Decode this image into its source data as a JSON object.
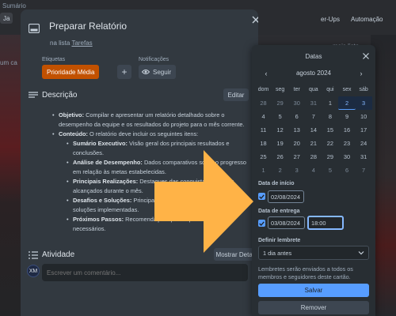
{
  "background": {
    "top_left_text": "Sumário",
    "board_btn": "Ja",
    "top_right_powerups": "er-Ups",
    "top_right_automation": "Automação",
    "left_fragment": "um ca",
    "right_fragment": "mais lista"
  },
  "card": {
    "title": "Preparar Relatório",
    "list_prefix": "na lista",
    "list_name": "Tarefas",
    "labels_heading": "Etiquetas",
    "label_chip": "Prioridade Média",
    "add_label": "+",
    "notifications_heading": "Notificações",
    "follow_label": "Seguir",
    "description_title": "Descrição",
    "edit_label": "Editar",
    "description": {
      "objective_key": "Objetivo:",
      "objective_text": " Compilar e apresentar um relatório detalhado sobre o desempenho da equipe e os resultados do projeto para o mês corrente.",
      "content_key": "Conteúdo:",
      "content_text": " O relatório deve incluir os seguintes itens:",
      "items": [
        {
          "key": "Sumário Executivo:",
          "text": " Visão geral dos principais resultados e conclusões."
        },
        {
          "key": "Análise de Desempenho:",
          "text": " Dados comparativos sobre o progresso em relação às metas estabelecidas."
        },
        {
          "key": "Principais Realizações:",
          "text": " Destaques das conquistas e marcos alcançados durante o mês."
        },
        {
          "key": "Desafios e Soluções:",
          "text": " Principais desafios enfrentados e as soluções implementadas."
        },
        {
          "key": "Próximos Passos:",
          "text": " Recomendações para o próximo mês, se necessários."
        }
      ]
    },
    "activity_title": "Atividade",
    "details_label": "Mostrar Detalhes",
    "avatar_initials": "XM",
    "comment_placeholder": "Escrever um comentário..."
  },
  "dates": {
    "title": "Datas",
    "prev_month": "‹",
    "next_month": "›",
    "month_label": "agosto 2024",
    "weekdays": [
      "dom",
      "seg",
      "ter",
      "qua",
      "qui",
      "sex",
      "sáb"
    ],
    "weeks": [
      [
        "28",
        "29",
        "30",
        "31",
        "1",
        "2",
        "3"
      ],
      [
        "4",
        "5",
        "6",
        "7",
        "8",
        "9",
        "10"
      ],
      [
        "11",
        "12",
        "13",
        "14",
        "15",
        "16",
        "17"
      ],
      [
        "18",
        "19",
        "20",
        "21",
        "22",
        "23",
        "24"
      ],
      [
        "25",
        "26",
        "27",
        "28",
        "29",
        "30",
        "31"
      ],
      [
        "1",
        "2",
        "3",
        "4",
        "5",
        "6",
        "7"
      ]
    ],
    "start_label": "Data de início",
    "start_value": "02/08/2024",
    "due_label": "Data de entrega",
    "due_date_value": "03/08/2024",
    "due_time_value": "18:00",
    "reminder_label": "Definir lembrete",
    "reminder_value": "1 dia antes",
    "help_text": "Lembretes serão enviados a todos os membros e seguidores deste cartão.",
    "save_label": "Salvar",
    "remove_label": "Remover"
  },
  "colors": {
    "modal_bg": "#323940",
    "popover_bg": "#282e33",
    "label_orange": "#c25100",
    "accent_blue": "#579dff",
    "overlay_arrow": "#ffb347"
  },
  "icons": {
    "card": "card-icon",
    "close": "close-icon",
    "eye": "eye-icon",
    "description": "description-icon",
    "activity": "activity-icon",
    "chevron_down": "chevron-down-icon",
    "check": "check-icon",
    "arrow": "arrow-right-icon"
  }
}
